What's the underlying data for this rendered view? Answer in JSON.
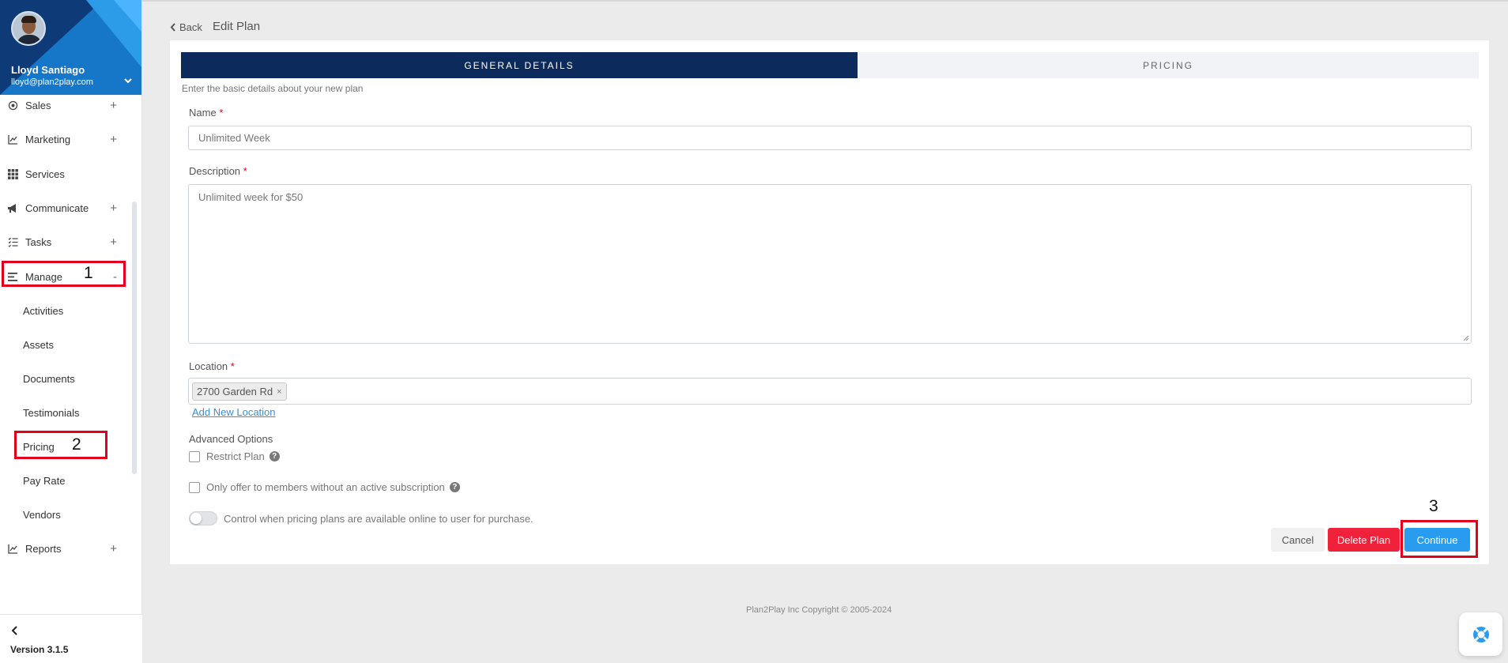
{
  "profile": {
    "name": "Lloyd Santiago",
    "email": "lloyd@plan2play.com"
  },
  "nav": {
    "items": [
      {
        "label": "Sales",
        "icon": "target-icon",
        "toggle": "+"
      },
      {
        "label": "Marketing",
        "icon": "chart-line-icon",
        "toggle": "+"
      },
      {
        "label": "Services",
        "icon": "grid-icon",
        "toggle": ""
      },
      {
        "label": "Communicate",
        "icon": "megaphone-icon",
        "toggle": "+"
      },
      {
        "label": "Tasks",
        "icon": "task-list-icon",
        "toggle": "+"
      },
      {
        "label": "Manage",
        "icon": "manage-list-icon",
        "toggle": "-"
      },
      {
        "label": "Reports",
        "icon": "chart-line-icon",
        "toggle": "+"
      }
    ],
    "manage_sub": [
      "Activities",
      "Assets",
      "Documents",
      "Testimonials",
      "Pricing",
      "Pay Rate",
      "Vendors"
    ]
  },
  "annotations": {
    "one": "1",
    "two": "2",
    "three": "3"
  },
  "version": "Version 3.1.5",
  "header": {
    "back_label": "Back",
    "title": "Edit Plan"
  },
  "tabs": {
    "general": "GENERAL DETAILS",
    "pricing": "PRICING"
  },
  "form": {
    "hint": "Enter the basic details about your new plan",
    "name_label": "Name",
    "name_value": "Unlimited Week",
    "description_label": "Description",
    "description_value": "Unlimited week for $50",
    "location_label": "Location",
    "location_chip": "2700 Garden Rd",
    "add_location": "Add New Location",
    "advanced_label": "Advanced Options",
    "restrict_label": "Restrict Plan",
    "only_offer_label": "Only offer to members without an active subscription",
    "control_label": "Control when pricing plans are available online to user for purchase.",
    "required_mark": "*"
  },
  "buttons": {
    "cancel": "Cancel",
    "delete": "Delete Plan",
    "continue": "Continue"
  },
  "footer": {
    "copyright": "Plan2Play Inc Copyright © 2005-2024"
  },
  "colors": {
    "tab_active": "#0c2a5b",
    "delete": "#f0213b",
    "continue": "#2a9cf0",
    "annotation_box": "#e3001b"
  }
}
